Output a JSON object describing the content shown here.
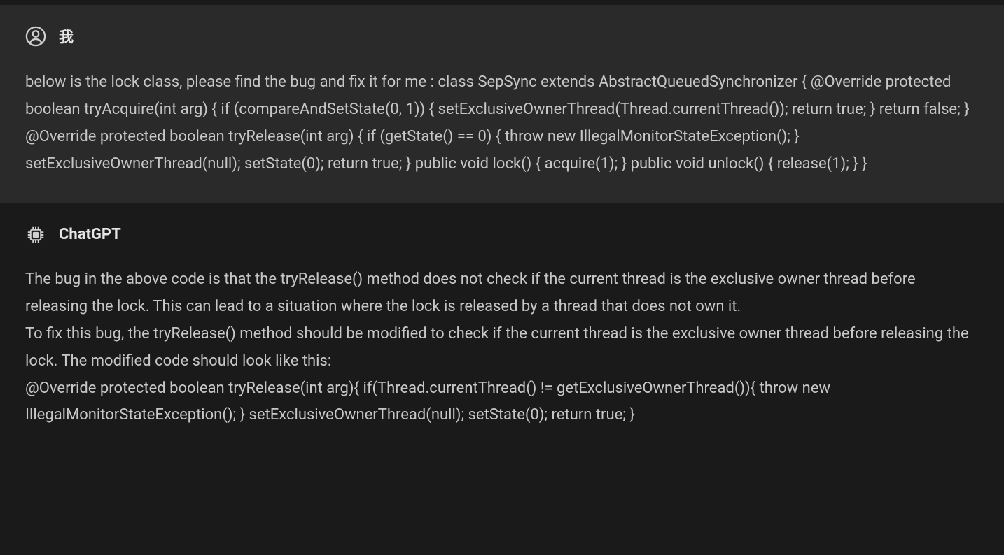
{
  "messages": {
    "user": {
      "sender": "我",
      "content": "below is the lock class, please find the bug and fix it for me : class SepSync extends AbstractQueuedSynchronizer { @Override protected boolean tryAcquire(int arg) { if (compareAndSetState(0, 1)) { setExclusiveOwnerThread(Thread.currentThread()); return true; } return false; } @Override protected boolean tryRelease(int arg) { if (getState() == 0) { throw new IllegalMonitorStateException(); } setExclusiveOwnerThread(null); setState(0); return true; } public void lock() { acquire(1); } public void unlock() { release(1); } }"
    },
    "assistant": {
      "sender": "ChatGPT",
      "content": "The bug in the above code is that the tryRelease() method does not check if the current thread is the exclusive owner thread before releasing the lock. This can lead to a situation where the lock is released by a thread that does not own it.\nTo fix this bug, the tryRelease() method should be modified to check if the current thread is the exclusive owner thread before releasing the lock. The modified code should look like this:\n@Override protected boolean tryRelease(int arg){ if(Thread.currentThread() != getExclusiveOwnerThread()){ throw new IllegalMonitorStateException(); } setExclusiveOwnerThread(null); setState(0); return true; }"
    }
  }
}
